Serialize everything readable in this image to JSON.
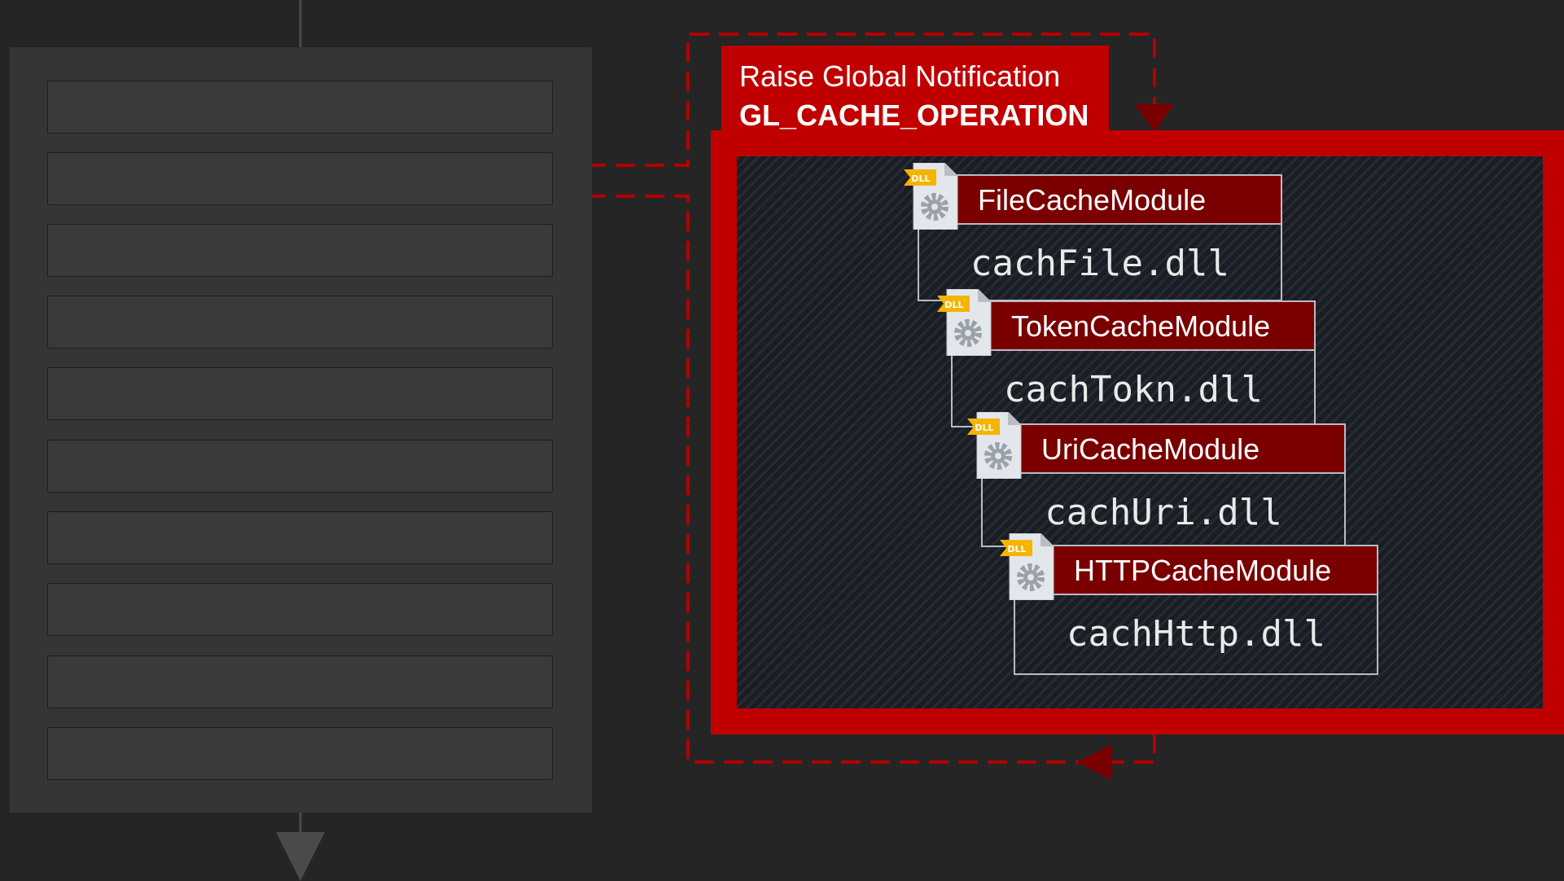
{
  "notification": {
    "action": "Raise Global Notification",
    "name": "GL_CACHE_OPERATION"
  },
  "pipeline": {
    "stage_count": 10
  },
  "modules": [
    {
      "name": "FileCacheModule",
      "file": "cachFile.dll",
      "icon": "dll-file-icon",
      "icon_badge": "DLL"
    },
    {
      "name": "TokenCacheModule",
      "file": "cachTokn.dll",
      "icon": "dll-file-icon",
      "icon_badge": "DLL"
    },
    {
      "name": "UriCacheModule",
      "file": "cachUri.dll",
      "icon": "dll-file-icon",
      "icon_badge": "DLL"
    },
    {
      "name": "HTTPCacheModule",
      "file": "cachHttp.dll",
      "icon": "dll-file-icon",
      "icon_badge": "DLL"
    }
  ],
  "colors": {
    "background": "#252525",
    "pipeline_panel": "#353535",
    "accent_red": "#c00000",
    "module_header": "#7a0000",
    "connector_red": "#b30000",
    "arrow_dark_red": "#7a0000",
    "icon_badge": "#f5b400"
  }
}
